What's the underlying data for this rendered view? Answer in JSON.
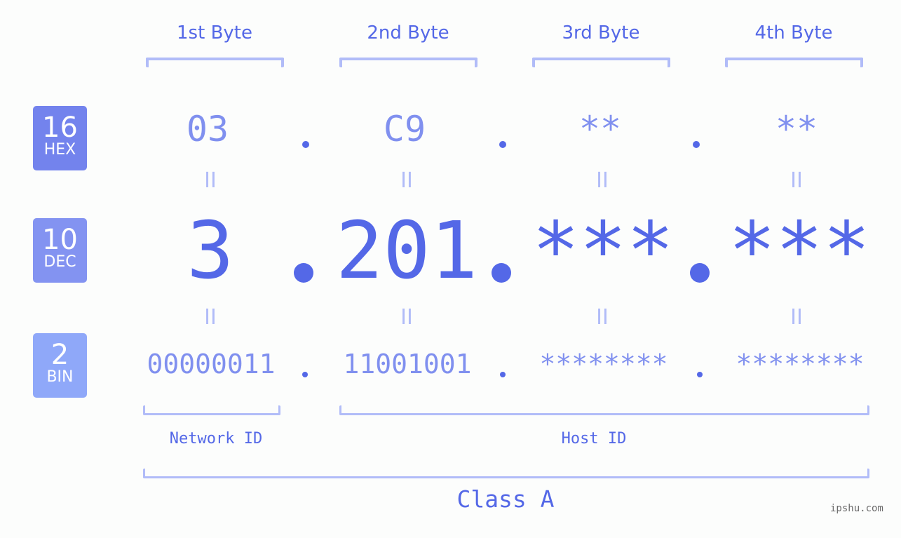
{
  "bytes": [
    {
      "header": "1st Byte",
      "hex": "03",
      "dec": "3",
      "bin": "00000011"
    },
    {
      "header": "2nd Byte",
      "hex": "C9",
      "dec": "201",
      "bin": "11001001"
    },
    {
      "header": "3rd Byte",
      "hex": "**",
      "dec": "***",
      "bin": "********"
    },
    {
      "header": "4th Byte",
      "hex": "**",
      "dec": "***",
      "bin": "********"
    }
  ],
  "badges": {
    "hex": {
      "num": "16",
      "label": "HEX",
      "color": "#7383ed"
    },
    "dec": {
      "num": "10",
      "label": "DEC",
      "color": "#8393f1"
    },
    "bin": {
      "num": "2",
      "label": "BIN",
      "color": "#8fa8f9"
    }
  },
  "equals_sign": "II",
  "network_label": "Network ID",
  "host_label": "Host ID",
  "class_label": "Class A",
  "watermark": "ipshu.com",
  "colors": {
    "primary": "#5468e7",
    "secondary": "#8090ef",
    "bracket": "#b1bcf8"
  }
}
